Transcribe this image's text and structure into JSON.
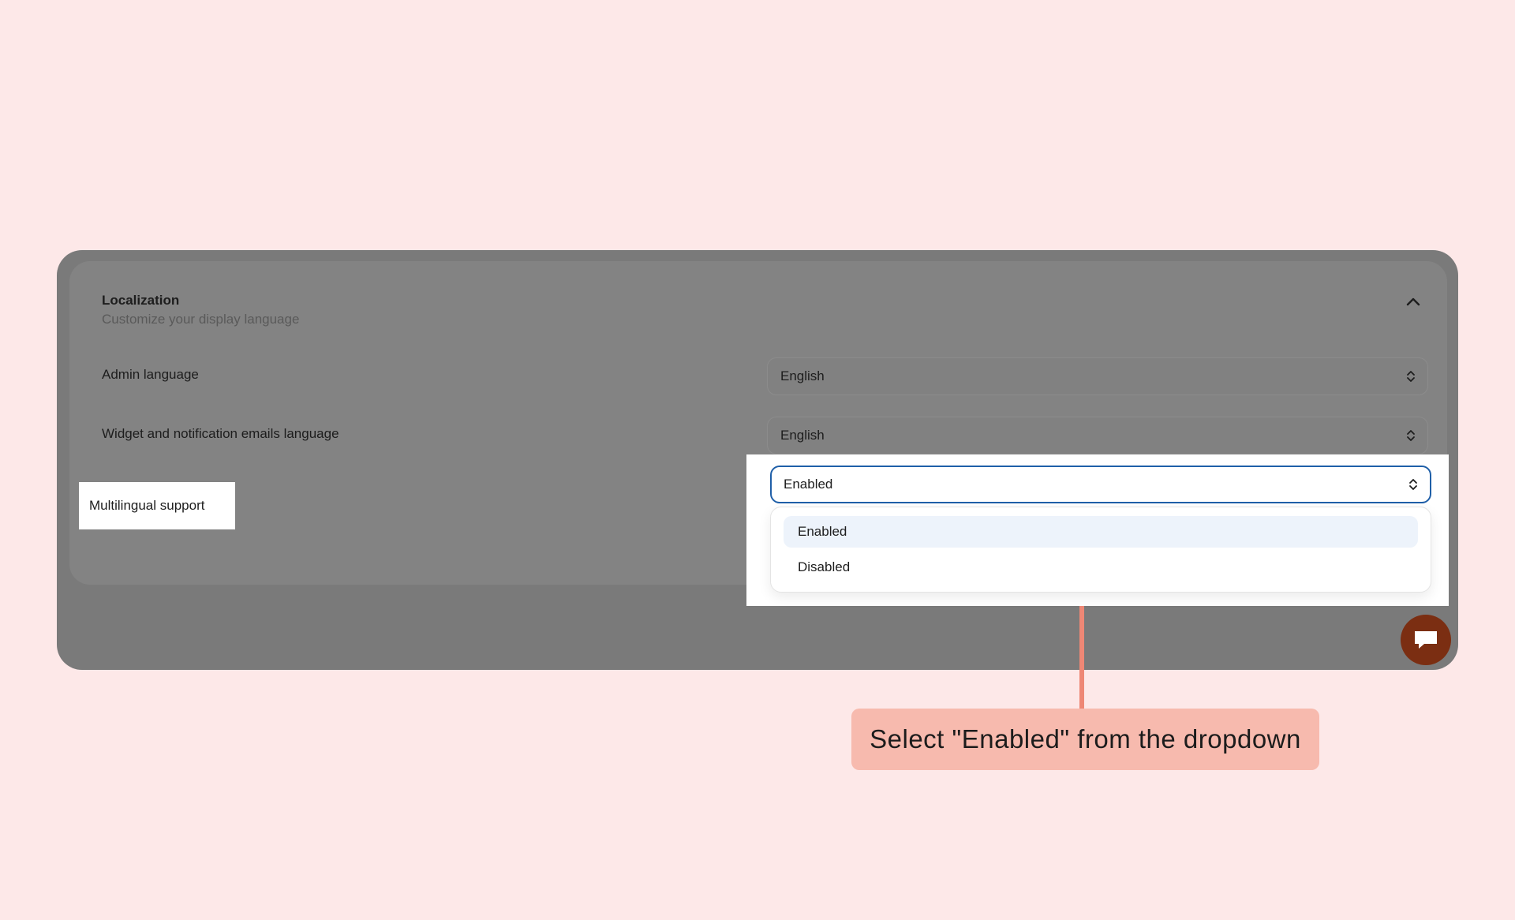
{
  "section": {
    "title": "Localization",
    "subtitle": "Customize your display language",
    "collapse_icon": "chevron-up-icon"
  },
  "settings": [
    {
      "label": "Admin language",
      "value": "English"
    },
    {
      "label": "Widget and notification emails language",
      "value": "English"
    },
    {
      "label": "Multilingual support",
      "value": "Enabled"
    }
  ],
  "dropdown": {
    "options": [
      "Enabled",
      "Disabled"
    ],
    "selected": "Enabled"
  },
  "chat": {
    "icon": "chat-bubble-icon"
  },
  "callout": {
    "text": "Select \"Enabled\" from the dropdown"
  },
  "colors": {
    "background": "#fde8e8",
    "overlay": "#7a7a7a",
    "focus_border": "#1f5fa8",
    "callout": "#f7baae",
    "connector": "#ee8775",
    "chat_button": "#7b2e12"
  }
}
